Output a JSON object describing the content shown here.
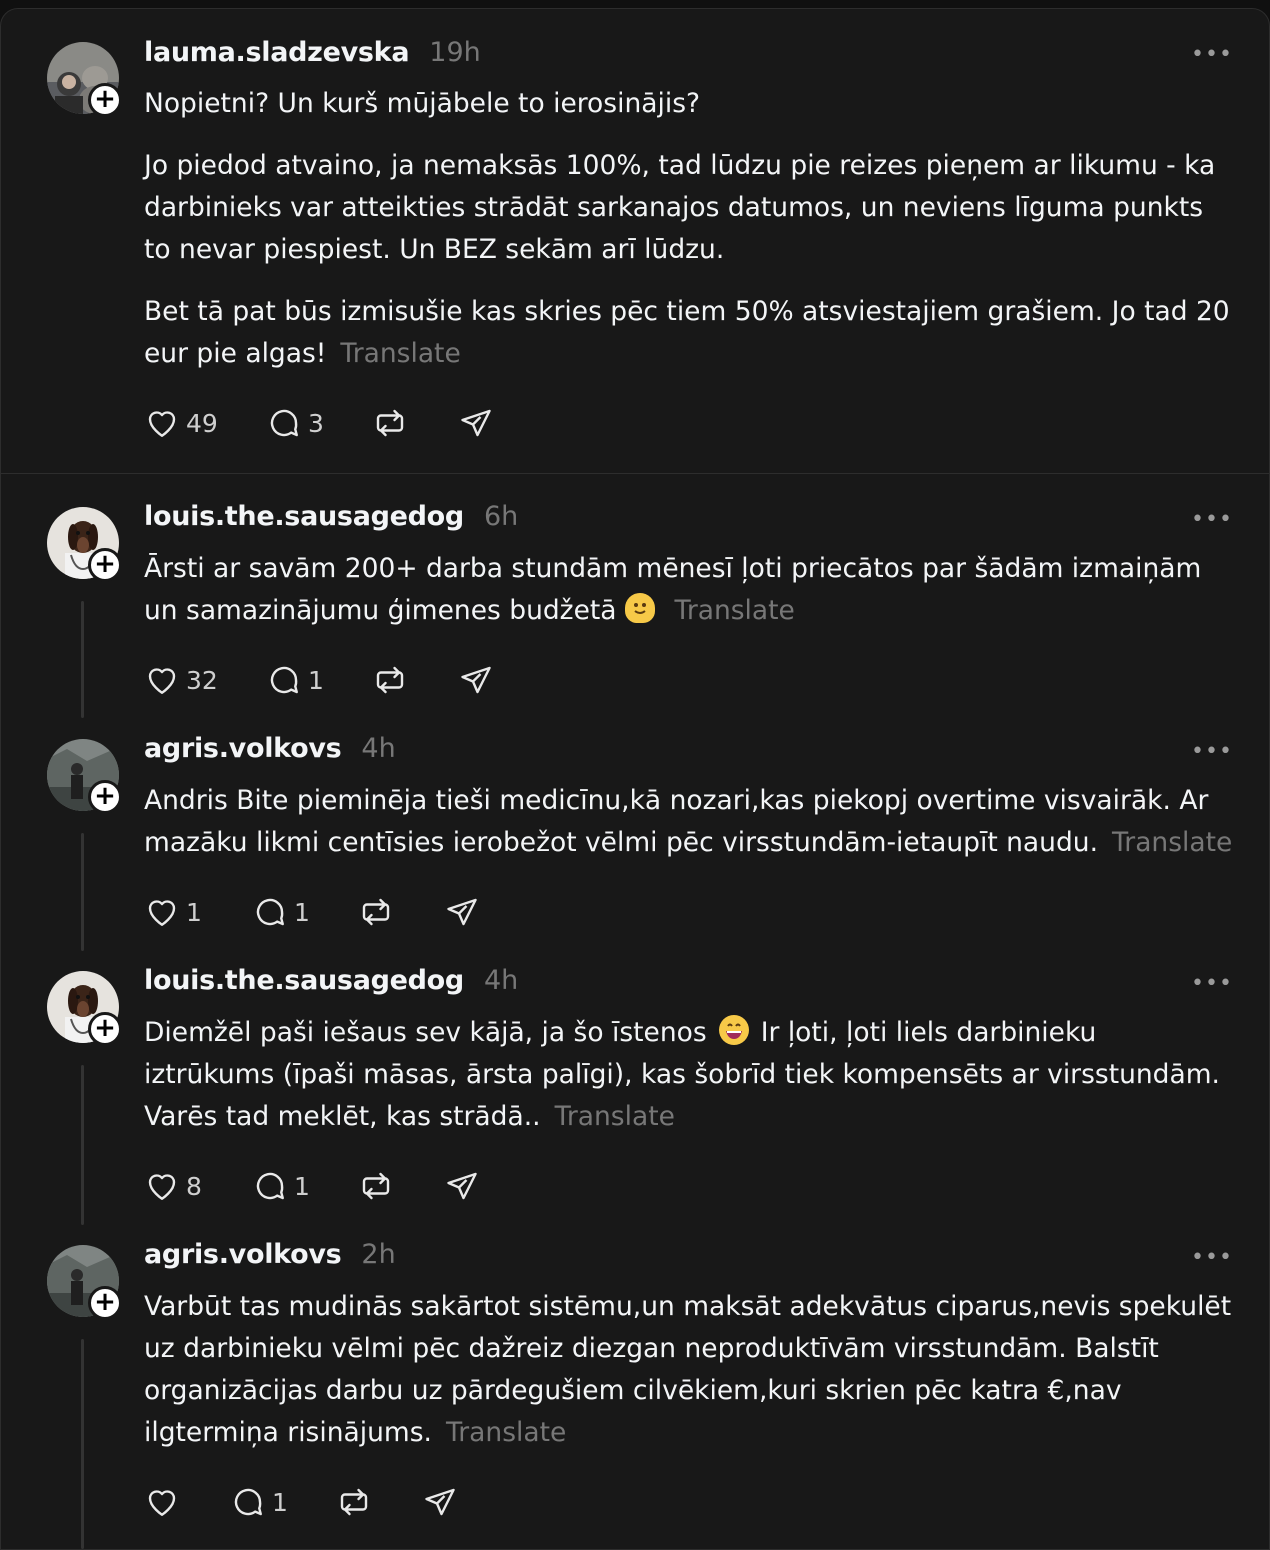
{
  "posts": [
    {
      "username": "lauma.sladzevska",
      "time": "19h",
      "paragraphs": [
        "Nopietni? Un kurš mūjābele to ierosinājis?",
        "Jo piedod atvaino, ja nemaksās 100%, tad lūdzu pie reizes pieņem ar likumu - ka darbinieks var atteikties strādāt sarkanajos datumos, un neviens līguma punkts to nevar piespiest. Un BEZ sekām arī lūdzu.",
        "Bet tā pat būs izmisušie kas skries pēc tiem 50% atsviestajiem grašiem. Jo tad 20 eur pie algas!"
      ],
      "translate": "Translate",
      "likes": "49",
      "replies": "3"
    },
    {
      "username": "louis.the.sausagedog",
      "time": "6h",
      "paragraphs": [
        "Ārsti ar savām 200+ darba stundām mēnesī ļoti priecātos par šādām izmaiņām un samazinājumu ģimenes budžetā"
      ],
      "emoji": "melting-face",
      "translate": "Translate",
      "likes": "32",
      "replies": "1"
    },
    {
      "username": "agris.volkovs",
      "time": "4h",
      "paragraphs": [
        "Andris Bite pieminēja tieši medicīnu,kā nozari,kas piekopj overtime visvairāk. Ar mazāku likmi centīsies ierobežot vēlmi pēc virsstundām-ietaupīt naudu."
      ],
      "translate": "Translate",
      "likes": "1",
      "replies": "1"
    },
    {
      "username": "louis.the.sausagedog",
      "time": "4h",
      "paragraphs_before_emoji": "Diemžēl paši iešaus sev kājā, ja šo īstenos",
      "paragraphs_after_emoji": "Ir ļoti, ļoti liels darbinieku iztrūkums (īpaši māsas, ārsta palīgi), kas šobrīd tiek kompensēts ar virsstundām. Varēs tad meklēt, kas strādā..",
      "emoji": "grinning-face",
      "translate": "Translate",
      "likes": "8",
      "replies": "1"
    },
    {
      "username": "agris.volkovs",
      "time": "2h",
      "paragraphs": [
        "Varbūt tas mudinās sakārtot sistēmu,un maksāt adekvātus ciparus,nevis spekulēt uz darbinieku vēlmi pēc dažreiz diezgan neproduktīvām virsstundām. Balstīt organizācijas darbu uz pārdegušiem cilvēkiem,kuri skrien pēc katra €,nav ilgtermiņa risinājums."
      ],
      "translate": "Translate",
      "likes": "",
      "replies": "1"
    }
  ],
  "icons": {
    "like": "heart-icon",
    "reply": "comment-icon",
    "repost": "repost-icon",
    "share": "send-icon",
    "more": "more-options-icon",
    "follow": "plus-icon"
  },
  "more_glyph": "•••",
  "follow_glyph": "+"
}
